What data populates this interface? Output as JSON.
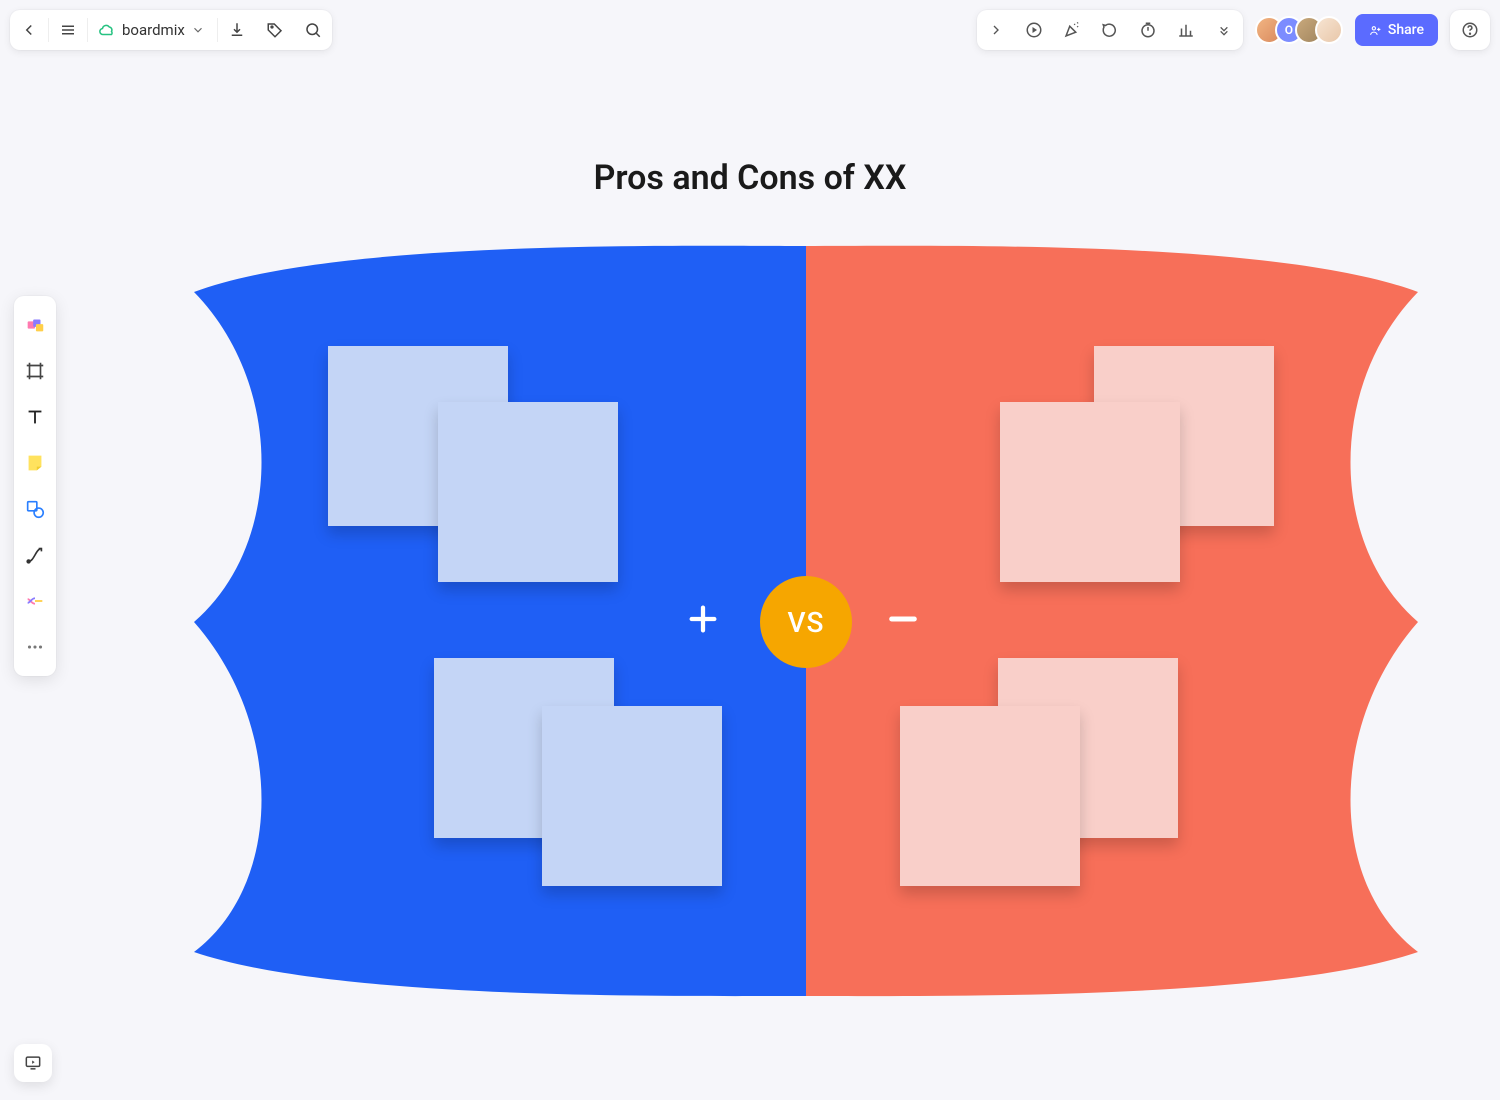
{
  "header": {
    "board_name": "boardmix",
    "share_label": "Share"
  },
  "canvas": {
    "title": "Pros and Cons of XX",
    "vs_label": "VS"
  },
  "colors": {
    "pros_bg": "#1f5ff5",
    "cons_bg": "#f76f59",
    "vs_badge": "#f6a600",
    "pros_note": "#c4d5f6",
    "cons_note": "#f9cfc9",
    "share_button": "#5b6bff"
  },
  "collaborators": [
    {
      "letter": "",
      "bg": "#e8a37a"
    },
    {
      "letter": "O",
      "bg": "#7c8cff"
    },
    {
      "letter": "",
      "bg": "#b39a7a"
    },
    {
      "letter": "",
      "bg": "#f0d9c4"
    }
  ]
}
